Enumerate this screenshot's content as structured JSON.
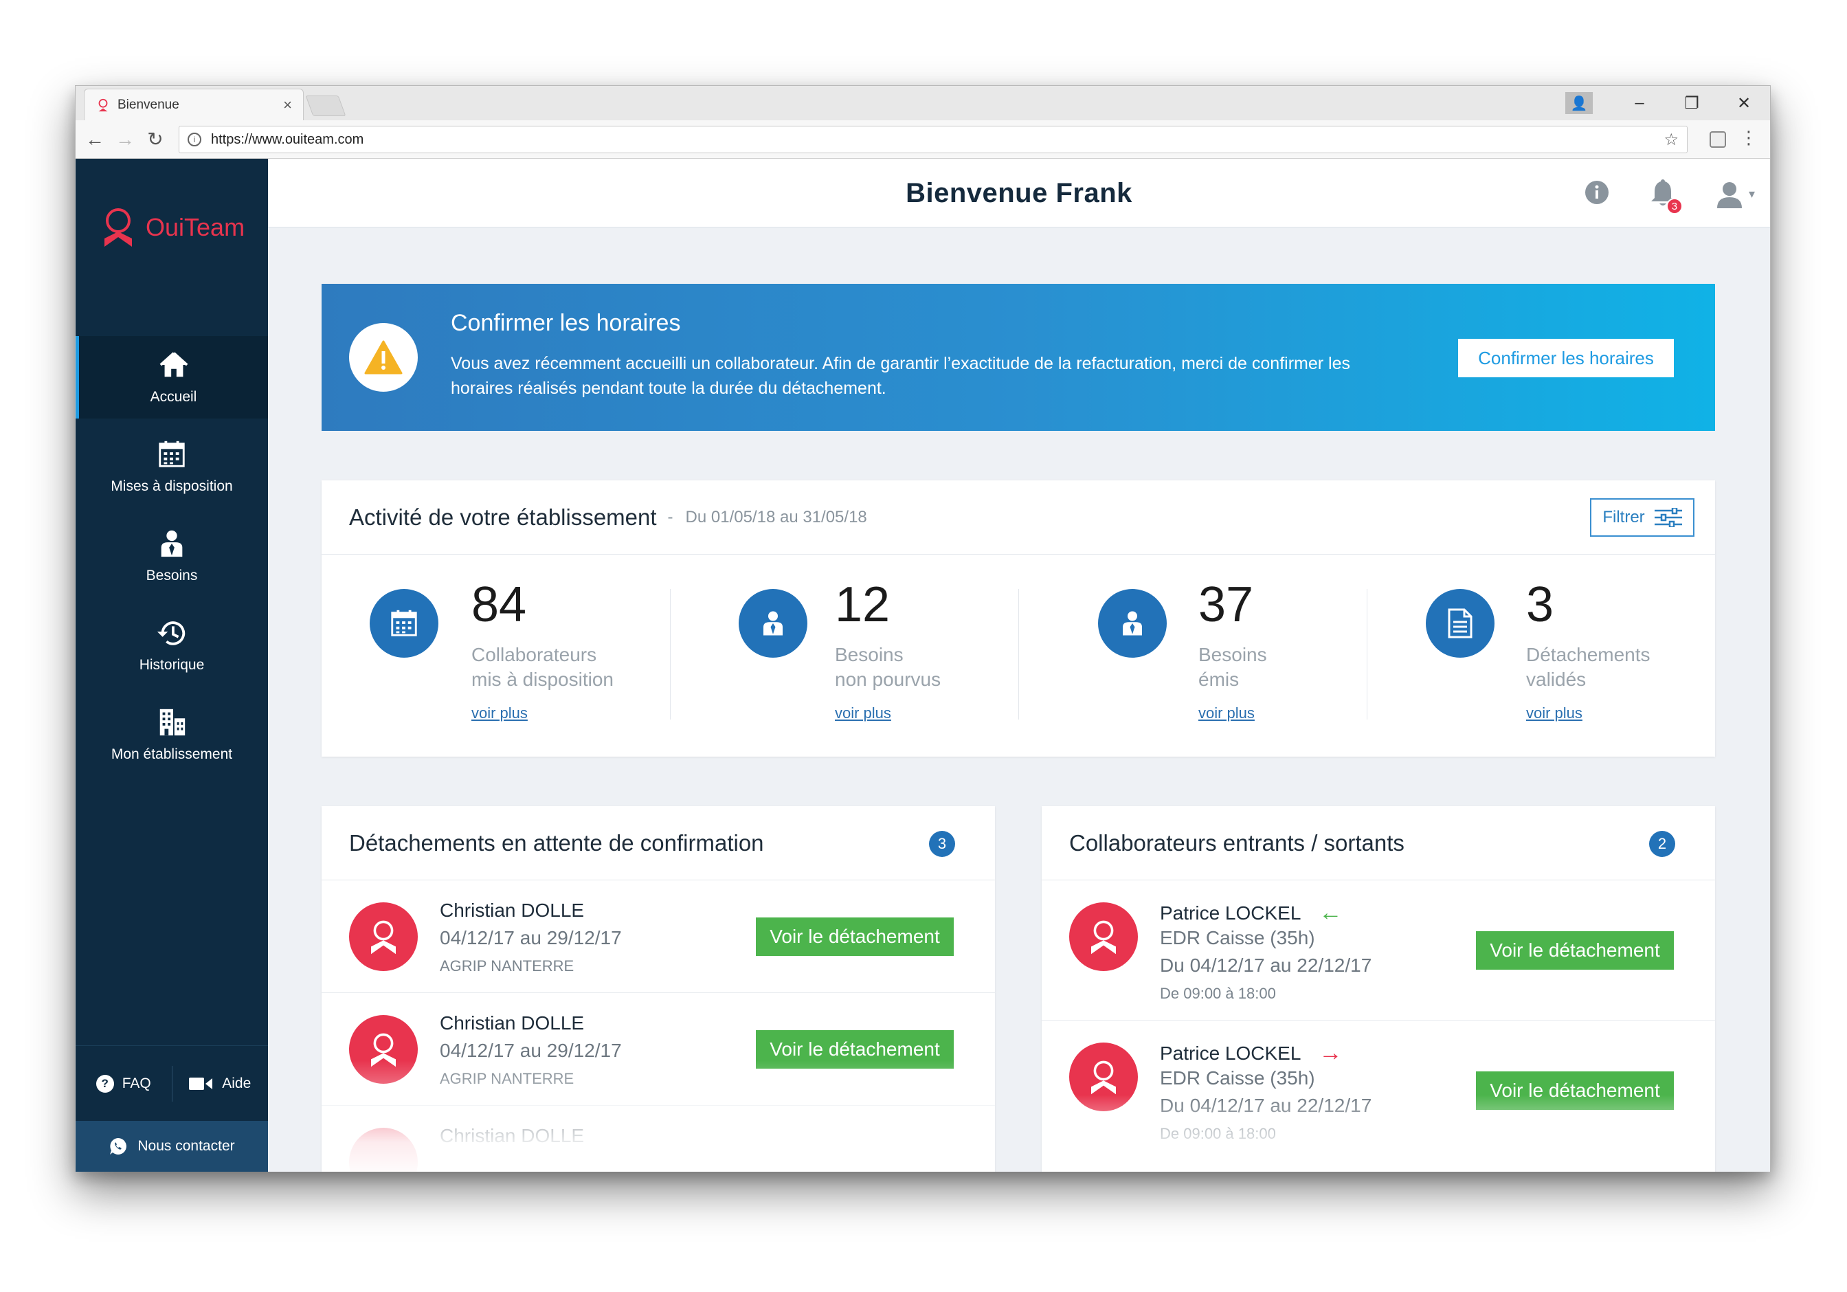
{
  "browser": {
    "tab_title": "Bienvenue",
    "url": "https://www.ouiteam.com",
    "controls": {
      "minimize": "–",
      "restore": "❐",
      "close": "✕"
    }
  },
  "sidebar": {
    "brand": "OuiTeam",
    "items": [
      {
        "label": "Accueil",
        "icon": "home-icon",
        "active": true
      },
      {
        "label": "Mises à disposition",
        "icon": "calendar-icon",
        "active": false
      },
      {
        "label": "Besoins",
        "icon": "person-icon",
        "active": false
      },
      {
        "label": "Historique",
        "icon": "history-icon",
        "active": false
      },
      {
        "label": "Mon établissement",
        "icon": "building-icon",
        "active": false
      }
    ],
    "faq_label": "FAQ",
    "help_label": "Aide",
    "contact_label": "Nous contacter"
  },
  "header": {
    "title": "Bienvenue Frank",
    "notification_count": "3"
  },
  "banner": {
    "title": "Confirmer les horaires",
    "text": "Vous avez récemment accueilli un collaborateur. Afin de garantir l’exactitude de la refacturation, merci de confirmer les horaires réalisés pendant toute la durée du détachement.",
    "button": "Confirmer les horaires"
  },
  "activity": {
    "title": "Activité de votre établissement",
    "period": "Du 01/05/18 au 31/05/18",
    "filter_label": "Filtrer",
    "stats": [
      {
        "value": "84",
        "line1": "Collaborateurs",
        "line2": "mis à disposition",
        "link": "voir plus",
        "icon": "calendar-icon"
      },
      {
        "value": "12",
        "line1": "Besoins",
        "line2": "non pourvus",
        "link": "voir plus",
        "icon": "person-icon"
      },
      {
        "value": "37",
        "line1": "Besoins",
        "line2": "émis",
        "link": "voir plus",
        "icon": "person-icon"
      },
      {
        "value": "3",
        "line1": "Détachements",
        "line2": "validés",
        "link": "voir plus",
        "icon": "document-icon"
      }
    ]
  },
  "pending": {
    "title": "Détachements en attente de confirmation",
    "count": "3",
    "rows": [
      {
        "name": "Christian DOLLE",
        "dates": "04/12/17 au 29/12/17",
        "place": "AGRIP NANTERRE",
        "button": "Voir le détachement"
      },
      {
        "name": "Christian DOLLE",
        "dates": "04/12/17 au 29/12/17",
        "place": "AGRIP NANTERRE",
        "button": "Voir le détachement"
      },
      {
        "name": "Christian DOLLE"
      }
    ]
  },
  "movements": {
    "title": "Collaborateurs entrants / sortants",
    "count": "2",
    "rows": [
      {
        "name": "Patrice LOCKEL",
        "direction": "entrant",
        "arrow": "←",
        "arrow_color": "#4cb44c",
        "role": "EDR Caisse (35h)",
        "dates": "Du 04/12/17 au 22/12/17",
        "hours": "De 09:00 à 18:00",
        "button": "Voir le détachement"
      },
      {
        "name": "Patrice LOCKEL",
        "direction": "sortant",
        "arrow": "→",
        "arrow_color": "#e8344e",
        "role": "EDR Caisse (35h)",
        "dates": "Du 04/12/17 au 22/12/17",
        "hours": "De 09:00 à 18:00",
        "button": "Voir le détachement"
      }
    ]
  },
  "colors": {
    "sidebar": "#0e2b42",
    "brand_red": "#e8344e",
    "primary_blue": "#2272b8",
    "accent_green": "#4cb44c"
  }
}
